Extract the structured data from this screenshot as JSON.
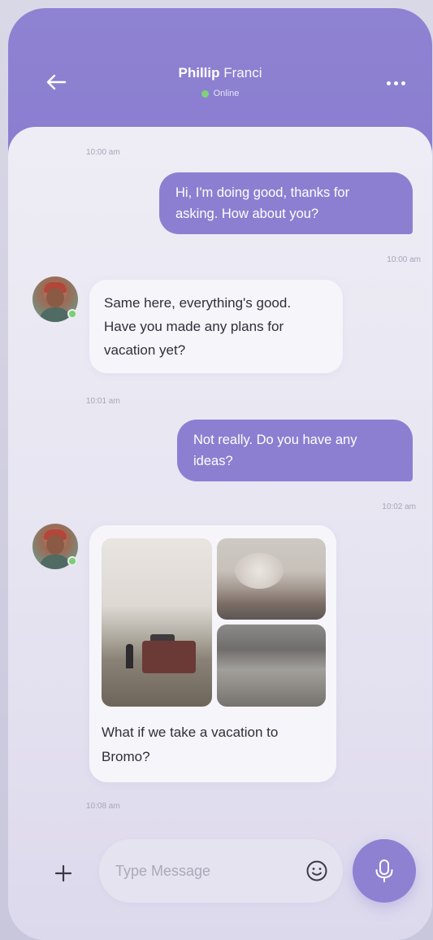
{
  "header": {
    "first_name": "Phillip",
    "last_name": "Franci",
    "status": "Online",
    "accent_color": "#8c7fd1",
    "status_color": "#7fd27b"
  },
  "messages": [
    {
      "time": "10:00 am"
    },
    {
      "direction": "out",
      "text_line1": "Hi, I'm doing good, thanks for",
      "text_line2": "asking. How about you?",
      "time": "10:00 am"
    },
    {
      "direction": "in",
      "text_line1": "Same here, everything's good.",
      "text_line2": "Have you made any plans for",
      "text_line3": "vacation yet?",
      "time": "10:01 am"
    },
    {
      "direction": "out",
      "text_line1": "Not really. Do you have any",
      "text_line2": "ideas?",
      "time": "10:02 am"
    },
    {
      "direction": "in",
      "type": "photos",
      "caption_line1": "What if we take a vacation to",
      "caption_line2": "Bromo?",
      "time": "10:08 am"
    }
  ],
  "composer": {
    "placeholder": "Type Message"
  },
  "icons": {
    "back": "arrow-left-icon",
    "menu": "more-horizontal-icon",
    "add": "plus-icon",
    "emoji": "smile-icon",
    "mic": "microphone-icon"
  }
}
